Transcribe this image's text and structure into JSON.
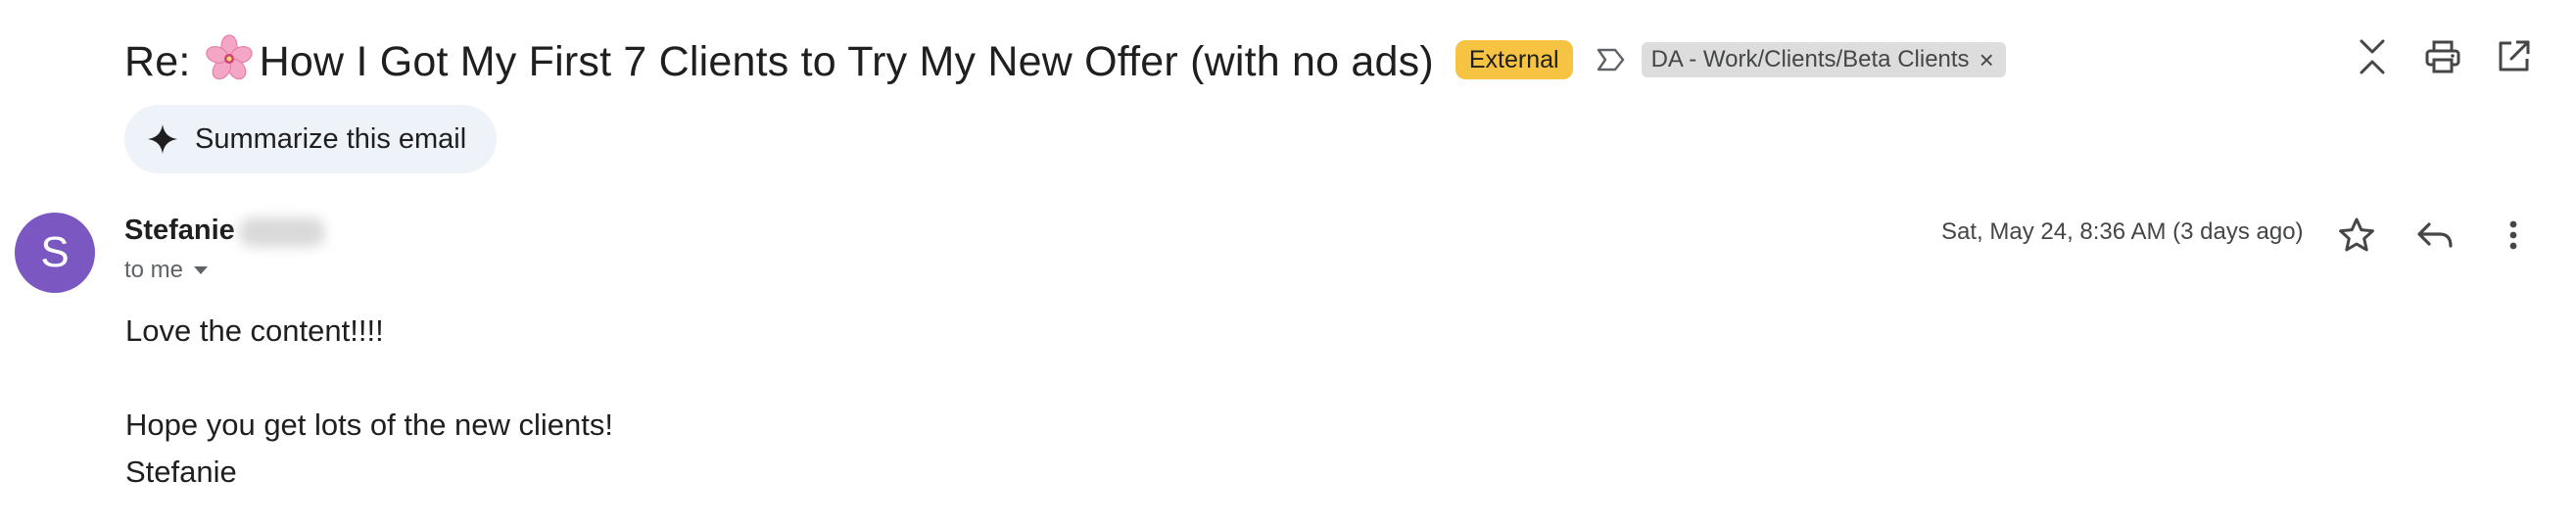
{
  "email": {
    "subject_prefix": "Re:",
    "subject_text": "How I Got My First 7 Clients to Try My New Offer (with no ads)",
    "badge": "External",
    "label_chip": "DA - Work/Clients/Beta Clients",
    "label_chip_remove": "×",
    "summarize_label": "Summarize this email",
    "sender": {
      "initial": "S",
      "first_name": "Stefanie",
      "avatar_color": "#7b57c2"
    },
    "recipient_label": "to me",
    "date": "Sat, May 24, 8:36 AM (3 days ago)",
    "body": {
      "line1": "Love the content!!!!",
      "line2": "Hope you get lots of the new clients!",
      "line3": "Stefanie"
    }
  },
  "icons": {
    "subject_emoji": "cherry-blossom-icon",
    "collapse": "collapse-all-icon",
    "print": "print-icon",
    "open_new": "open-in-new-window-icon",
    "star": "star-icon",
    "reply": "reply-icon",
    "more": "more-vertical-icon",
    "summarize": "sparkle-icon",
    "label": "label-arrow-icon"
  },
  "colors": {
    "external_badge": "#f6c343",
    "label_chip": "#dddddd",
    "summarize_bg": "#eef2f9"
  }
}
